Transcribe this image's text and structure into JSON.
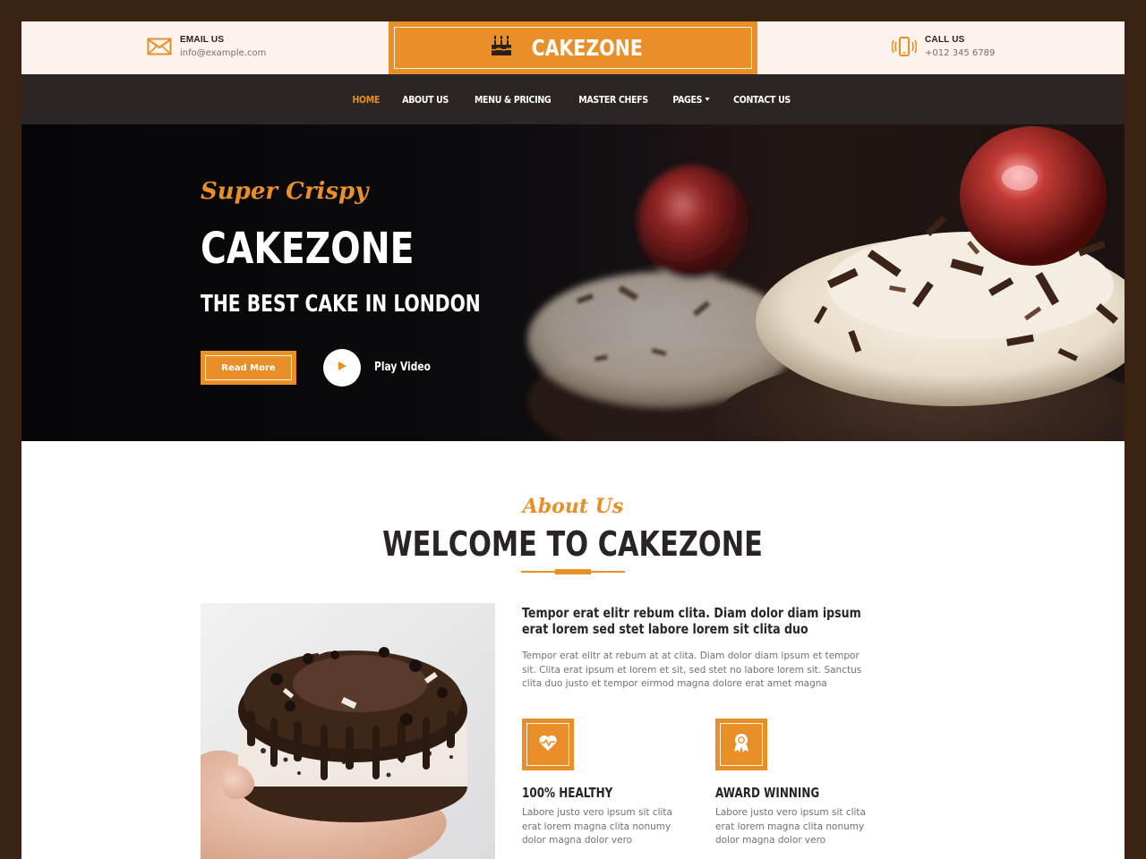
{
  "topbar": {
    "email": {
      "label": "EMAIL US",
      "value": "info@example.com",
      "icon": "envelope-icon"
    },
    "phone": {
      "label": "CALL US",
      "value": "+012 345 6789",
      "icon": "phone-vibrate-icon"
    },
    "brand": {
      "name": "CAKEZONE",
      "icon": "birthday-cake-icon"
    }
  },
  "nav": {
    "items": [
      {
        "label": "HOME",
        "active": true
      },
      {
        "label": "ABOUT US"
      },
      {
        "label": "MENU & PRICING"
      },
      {
        "label": "MASTER CHEFS"
      },
      {
        "label": "PAGES",
        "dropdown": true
      },
      {
        "label": "CONTACT US"
      }
    ]
  },
  "hero": {
    "script": "Super Crispy",
    "title": "CAKEZONE",
    "subtitle": "THE BEST CAKE IN LONDON",
    "read_more": "Read More",
    "play_label": "Play Video"
  },
  "about": {
    "script": "About Us",
    "title": "WELCOME TO CAKEZONE",
    "lead": "Tempor erat elitr rebum clita. Diam dolor diam ipsum erat lorem sed stet labore lorem sit clita duo",
    "body": "Tempor erat elitr at rebum at at clita. Diam dolor diam ipsum et tempor sit. Clita erat ipsum et lorem et sit, sed stet no labore lorem sit. Sanctus clita duo justo et tempor eirmod magna dolore erat amet magna",
    "features": [
      {
        "icon": "heart-pulse-icon",
        "title": "100% HEALTHY",
        "body": "Labore justo vero ipsum sit clita erat lorem magna clita nonumy dolor magna dolor vero"
      },
      {
        "icon": "award-ribbon-icon",
        "title": "AWARD WINNING",
        "body": "Labore justo vero ipsum sit clita erat lorem magna clita nonumy dolor magna dolor vero"
      }
    ]
  },
  "colors": {
    "accent": "#e88f2a",
    "dark": "#2b2523",
    "frame": "#3a2312",
    "topbar_bg": "#fbf3ec"
  }
}
